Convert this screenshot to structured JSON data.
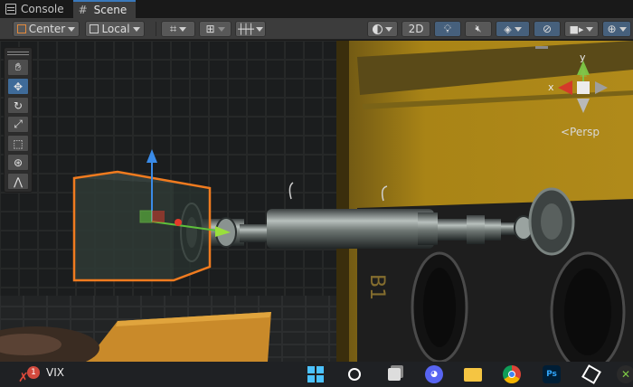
{
  "tabs": [
    {
      "label": "Console",
      "icon": "console-icon",
      "active": false
    },
    {
      "label": "Scene",
      "icon": "grid-icon",
      "active": true
    }
  ],
  "toolbar": {
    "pivot_label": "Center",
    "handle_label": "Local",
    "mode_2d_label": "2D"
  },
  "tool_palette": [
    "hand-tool",
    "move-tool",
    "rotate-tool",
    "scale-tool",
    "rect-tool",
    "transform-tool",
    "custom-tool"
  ],
  "gizmo": {
    "y_label": "y",
    "x_label": "x",
    "projection_label": "<Persp"
  },
  "taskbar": {
    "notification_count": "1",
    "widget_label": "VIX",
    "apps": [
      "windows-start",
      "search",
      "task-view",
      "discord",
      "file-explorer",
      "chrome",
      "photoshop",
      "unity",
      "xbox"
    ]
  },
  "colors": {
    "accent": "#3a79bb",
    "selection_outline": "#f07b1f",
    "axis_x": "#d43a2a",
    "axis_y": "#3a8be8",
    "axis_z": "#5ec03b"
  }
}
